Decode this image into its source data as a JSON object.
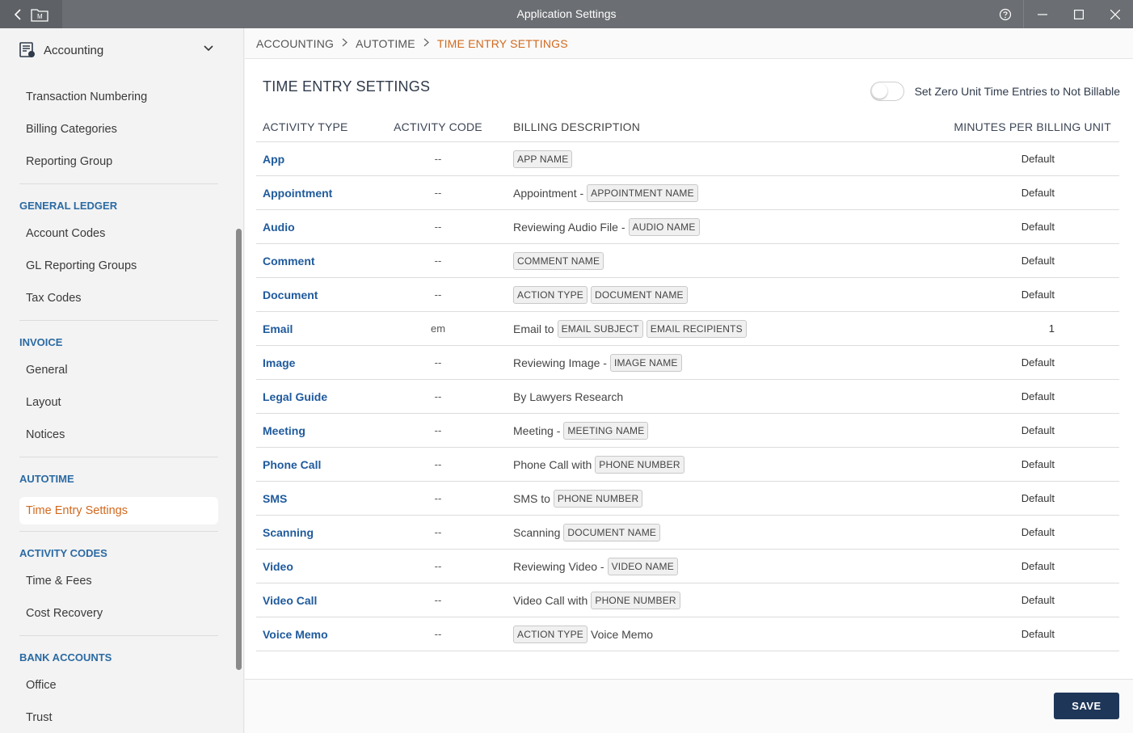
{
  "window": {
    "title": "Application Settings"
  },
  "sidebar": {
    "module_label": "Accounting",
    "top_items": [
      "Transaction Numbering",
      "Billing Categories",
      "Reporting Group"
    ],
    "sections": [
      {
        "title": "GENERAL LEDGER",
        "items": [
          "Account Codes",
          "GL Reporting Groups",
          "Tax Codes"
        ]
      },
      {
        "title": "INVOICE",
        "items": [
          "General",
          "Layout",
          "Notices"
        ]
      },
      {
        "title": "AUTOTIME",
        "items": [
          "Time Entry Settings"
        ],
        "active": "Time Entry Settings"
      },
      {
        "title": "ACTIVITY CODES",
        "items": [
          "Time & Fees",
          "Cost Recovery"
        ]
      },
      {
        "title": "BANK ACCOUNTS",
        "items": [
          "Office",
          "Trust"
        ]
      }
    ]
  },
  "breadcrumb": [
    "ACCOUNTING",
    "AUTOTIME",
    "TIME ENTRY SETTINGS"
  ],
  "page": {
    "title": "TIME ENTRY SETTINGS",
    "toggle_label": "Set Zero Unit Time Entries to Not Billable",
    "toggle_on": false
  },
  "table": {
    "headers": {
      "activity_type": "ACTIVITY TYPE",
      "activity_code": "ACTIVITY CODE",
      "billing_description": "BILLING DESCRIPTION",
      "minutes": "MINUTES PER BILLING UNIT"
    },
    "rows": [
      {
        "type": "App",
        "code": "--",
        "desc": [
          {
            "token": "APP NAME"
          }
        ],
        "minutes": "Default"
      },
      {
        "type": "Appointment",
        "code": "--",
        "desc": [
          {
            "text": "Appointment -"
          },
          {
            "token": "APPOINTMENT NAME"
          }
        ],
        "minutes": "Default"
      },
      {
        "type": "Audio",
        "code": "--",
        "desc": [
          {
            "text": "Reviewing Audio File -"
          },
          {
            "token": "AUDIO NAME"
          }
        ],
        "minutes": "Default"
      },
      {
        "type": "Comment",
        "code": "--",
        "desc": [
          {
            "token": "COMMENT NAME"
          }
        ],
        "minutes": "Default"
      },
      {
        "type": "Document",
        "code": "--",
        "desc": [
          {
            "token": "ACTION TYPE"
          },
          {
            "token": "DOCUMENT NAME"
          }
        ],
        "minutes": "Default"
      },
      {
        "type": "Email",
        "code": "em",
        "desc": [
          {
            "text": "Email to"
          },
          {
            "token": "EMAIL SUBJECT"
          },
          {
            "token": "EMAIL RECIPIENTS"
          }
        ],
        "minutes": "1"
      },
      {
        "type": "Image",
        "code": "--",
        "desc": [
          {
            "text": "Reviewing Image -"
          },
          {
            "token": "IMAGE NAME"
          }
        ],
        "minutes": "Default"
      },
      {
        "type": "Legal Guide",
        "code": "--",
        "desc": [
          {
            "text": "By Lawyers Research"
          }
        ],
        "minutes": "Default"
      },
      {
        "type": "Meeting",
        "code": "--",
        "desc": [
          {
            "text": "Meeting -"
          },
          {
            "token": "MEETING NAME"
          }
        ],
        "minutes": "Default"
      },
      {
        "type": "Phone Call",
        "code": "--",
        "desc": [
          {
            "text": "Phone Call with"
          },
          {
            "token": "PHONE NUMBER"
          }
        ],
        "minutes": "Default"
      },
      {
        "type": "SMS",
        "code": "--",
        "desc": [
          {
            "text": "SMS to"
          },
          {
            "token": "PHONE NUMBER"
          }
        ],
        "minutes": "Default"
      },
      {
        "type": "Scanning",
        "code": "--",
        "desc": [
          {
            "text": "Scanning"
          },
          {
            "token": "DOCUMENT NAME"
          }
        ],
        "minutes": "Default"
      },
      {
        "type": "Video",
        "code": "--",
        "desc": [
          {
            "text": "Reviewing Video -"
          },
          {
            "token": "VIDEO NAME"
          }
        ],
        "minutes": "Default"
      },
      {
        "type": "Video Call",
        "code": "--",
        "desc": [
          {
            "text": "Video Call with"
          },
          {
            "token": "PHONE NUMBER"
          }
        ],
        "minutes": "Default"
      },
      {
        "type": "Voice Memo",
        "code": "--",
        "desc": [
          {
            "token": "ACTION TYPE"
          },
          {
            "text": "Voice Memo"
          }
        ],
        "minutes": "Default"
      }
    ]
  },
  "footer": {
    "save_label": "SAVE"
  },
  "colors": {
    "accent": "#d2691e",
    "link": "#1f5a9c",
    "primary_button": "#1e3658",
    "section_title": "#2b6aa3"
  },
  "icons": {
    "back": "chevron-left-icon",
    "app": "folder-m-icon",
    "help": "help-circle-icon",
    "minimize": "minimize-icon",
    "maximize": "maximize-icon",
    "close": "close-icon",
    "module": "accounting-ledger-icon",
    "expand": "chevron-down-icon"
  }
}
